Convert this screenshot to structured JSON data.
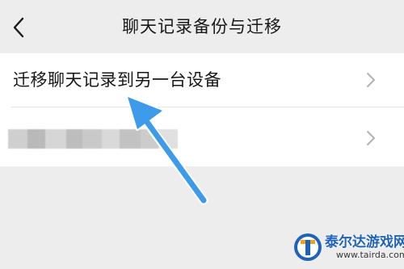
{
  "header": {
    "title": "聊天记录备份与迁移",
    "back_icon": "chevron-left-icon"
  },
  "list": {
    "items": [
      {
        "label": "迁移聊天记录到另一台设备",
        "icon": "chevron-right-icon"
      },
      {
        "label": "",
        "redacted": true,
        "icon": "chevron-right-icon"
      }
    ]
  },
  "annotation": {
    "arrow_color": "#3d9be9"
  },
  "watermark": {
    "name": "泰尔达游戏网",
    "url": "www.tairda.com",
    "logo_icon": "t-logo-icon"
  },
  "colors": {
    "background": "#ededed",
    "list_background": "#ffffff",
    "text": "#181818",
    "chevron": "#b2b2b2"
  }
}
